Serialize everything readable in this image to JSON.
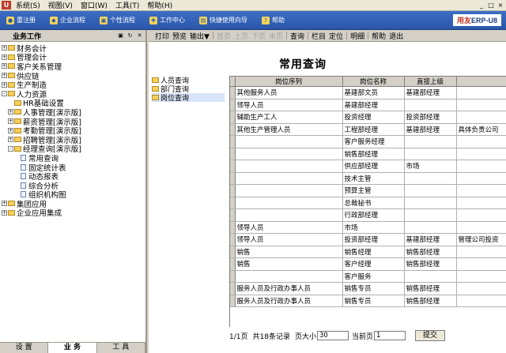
{
  "menubar": {
    "logo": "U",
    "items": [
      "系统(S)",
      "视图(V)",
      "窗口(W)",
      "工具(T)",
      "帮助(H)"
    ],
    "win_controls": [
      "_",
      "□",
      "×"
    ]
  },
  "topbar": {
    "buttons": [
      "重注册",
      "企业流程",
      "个性流程",
      "工作中心",
      "快捷使用向导",
      "帮助"
    ],
    "brand_a": "用友",
    "brand_b": "ERP-U8"
  },
  "left_panel": {
    "header": "业务工作",
    "header_icons": [
      "save-icon",
      "refresh-icon",
      "close-icon"
    ],
    "tree": [
      {
        "label": "财务会计",
        "level": 0,
        "expander": "+",
        "type": "folder"
      },
      {
        "label": "管理会计",
        "level": 0,
        "expander": "+",
        "type": "folder"
      },
      {
        "label": "客户关系管理",
        "level": 0,
        "expander": "+",
        "type": "folder"
      },
      {
        "label": "供应链",
        "level": 0,
        "expander": "+",
        "type": "folder"
      },
      {
        "label": "生产制造",
        "level": 0,
        "expander": "+",
        "type": "folder"
      },
      {
        "label": "人力资源",
        "level": 0,
        "expander": "-",
        "type": "folder"
      },
      {
        "label": "HR基础设置",
        "level": 1,
        "expander": "",
        "type": "folder"
      },
      {
        "label": "人事管理[演示版]",
        "level": 1,
        "expander": "+",
        "type": "folder"
      },
      {
        "label": "薪资管理[演示版]",
        "level": 1,
        "expander": "+",
        "type": "folder"
      },
      {
        "label": "考勤管理[演示版]",
        "level": 1,
        "expander": "+",
        "type": "folder"
      },
      {
        "label": "招聘管理[演示版]",
        "level": 1,
        "expander": "+",
        "type": "folder"
      },
      {
        "label": "经理查询[演示版]",
        "level": 1,
        "expander": "-",
        "type": "folder"
      },
      {
        "label": "常用查询",
        "level": 2,
        "expander": "",
        "type": "doc"
      },
      {
        "label": "固定统计表",
        "level": 2,
        "expander": "",
        "type": "doc"
      },
      {
        "label": "动态报表",
        "level": 2,
        "expander": "",
        "type": "doc"
      },
      {
        "label": "综合分析",
        "level": 2,
        "expander": "",
        "type": "doc"
      },
      {
        "label": "组织机构图",
        "level": 2,
        "expander": "",
        "type": "doc"
      },
      {
        "label": "集团应用",
        "level": 0,
        "expander": "+",
        "type": "folder"
      },
      {
        "label": "企业应用集成",
        "level": 0,
        "expander": "+",
        "type": "folder"
      }
    ],
    "tabs": [
      "设 置",
      "业 务",
      "工 具"
    ],
    "active_tab": 1
  },
  "toolbar": {
    "items": [
      {
        "label": "打印",
        "enabled": true
      },
      {
        "label": "预览",
        "enabled": true
      },
      {
        "label": "输出▼",
        "enabled": true
      },
      {
        "sep": true
      },
      {
        "label": "首页",
        "enabled": false
      },
      {
        "label": "上页",
        "enabled": false
      },
      {
        "label": "下页",
        "enabled": false
      },
      {
        "label": "末页",
        "enabled": false
      },
      {
        "sep": true
      },
      {
        "label": "查询",
        "enabled": true
      },
      {
        "sep": true
      },
      {
        "label": "栏目",
        "enabled": true
      },
      {
        "label": "定位",
        "enabled": true
      },
      {
        "sep": true
      },
      {
        "label": "明细",
        "enabled": true
      },
      {
        "sep": true
      },
      {
        "label": "帮助",
        "enabled": true
      },
      {
        "label": "退出",
        "enabled": true
      }
    ]
  },
  "query": {
    "title": "常用查询",
    "tree": [
      "人员查询",
      "部门查询",
      "岗位查询"
    ],
    "columns": [
      "岗位序列",
      "岗位名称",
      "直接上级",
      ""
    ],
    "rows": [
      [
        "其他服务人员",
        "基建部文员",
        "基建部经理",
        ""
      ],
      [
        "领导人员",
        "基建部经理",
        "",
        ""
      ],
      [
        "辅助生产工人",
        "投资经理",
        "投资部经理",
        ""
      ],
      [
        "其他生产管理人员",
        "工程部经理",
        "基建部经理",
        "具体负责公司"
      ],
      [
        "",
        "客户服务经理",
        "",
        ""
      ],
      [
        "",
        "销售部经理",
        "",
        ""
      ],
      [
        "",
        "供应部经理",
        "市场",
        ""
      ],
      [
        "",
        "技术主管",
        "",
        ""
      ],
      [
        "",
        "预算主管",
        "",
        ""
      ],
      [
        "",
        "总裁秘书",
        "",
        ""
      ],
      [
        "",
        "行政部经理",
        "",
        ""
      ],
      [
        "领导人员",
        "市场",
        "",
        ""
      ],
      [
        "领导人员",
        "投资部经理",
        "基建部经理",
        "管理公司投资"
      ],
      [
        "销售",
        "销售经理",
        "销售部经理",
        ""
      ],
      [
        "销售",
        "客户经理",
        "销售部经理",
        ""
      ],
      [
        "",
        "客户服务",
        "",
        ""
      ],
      [
        "服务人员及行政办事人员",
        "销售专员",
        "销售部经理",
        ""
      ],
      [
        "服务人员及行政办事人员",
        "销售专员",
        "销售部经理",
        ""
      ]
    ],
    "footer": {
      "page_info": "1/1页",
      "total_records": "共18条记录",
      "page_size_label": "页大小",
      "page_size": "30",
      "current_page_label": "当前页",
      "current_page": "1",
      "submit": "提交"
    }
  }
}
